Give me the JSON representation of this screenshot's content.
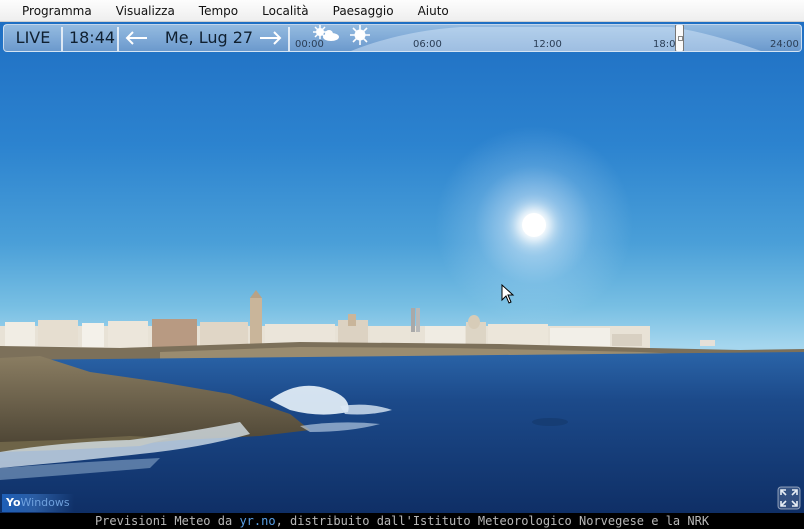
{
  "menu": {
    "items": [
      {
        "label": "Programma"
      },
      {
        "label": "Visualizza"
      },
      {
        "label": "Tempo"
      },
      {
        "label": "Località"
      },
      {
        "label": "Paesaggio"
      },
      {
        "label": "Aiuto"
      }
    ]
  },
  "controls": {
    "live_label": "LIVE",
    "time": "18:44",
    "prev_icon": "arrow-left-icon",
    "next_icon": "arrow-right-icon",
    "date": "Me, Lug 27"
  },
  "timeline": {
    "ticks": [
      "00:00",
      "06:00",
      "12:00",
      "18:0",
      "24:00"
    ],
    "weather_icons": [
      "partly-cloudy-icon",
      "sun-icon"
    ],
    "position_fraction": 0.78
  },
  "logo": {
    "main": "Yo",
    "sub": "Windows"
  },
  "footer": {
    "prefix": "Previsioni Meteo da ",
    "link": "yr.no",
    "suffix": ", distribuito dall'Istituto Meteorologico Norvegese e la NRK"
  },
  "colors": {
    "sky_top": "#1f6fc3",
    "sky_horizon": "#a5d6ee",
    "sea": "#1c4a8a",
    "link": "#5aa0e6"
  }
}
